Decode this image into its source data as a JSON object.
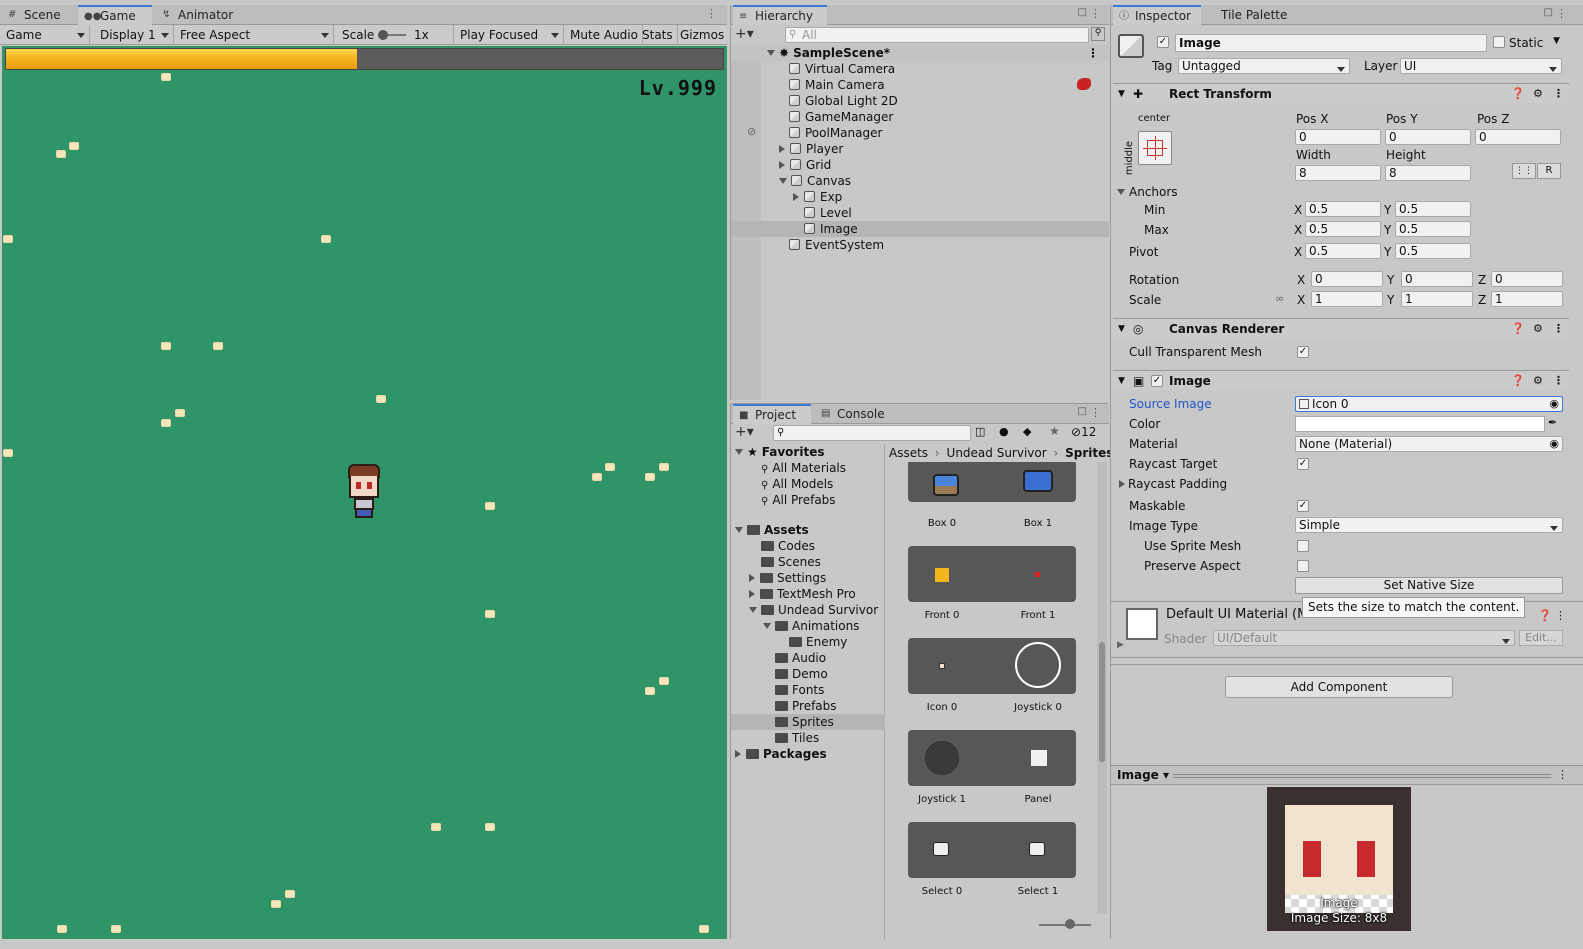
{
  "game_panel": {
    "tabs": [
      {
        "label": "Scene",
        "icon": "hash-icon"
      },
      {
        "label": "Game",
        "icon": "gamepad-icon"
      },
      {
        "label": "Animator",
        "icon": "animator-icon"
      }
    ],
    "toolbar": {
      "game_mode": "Game",
      "display": "Display 1",
      "aspect": "Free Aspect",
      "scale_label": "Scale",
      "scale_value": "1x",
      "play_focused": "Play Focused",
      "mute_audio": "Mute Audio",
      "stats": "Stats",
      "gizmos": "Gizmos"
    },
    "exp_bar_fill": 0.49,
    "level_text": "Lv.999",
    "colors": {
      "grass": "#2f9467",
      "exp_bar": "#f5b51e"
    }
  },
  "hierarchy": {
    "tab": "Hierarchy",
    "search_placeholder": "All",
    "scene": "SampleScene*",
    "items": [
      {
        "label": "Virtual Camera"
      },
      {
        "label": "Main Camera"
      },
      {
        "label": "Global Light 2D"
      },
      {
        "label": "GameManager"
      },
      {
        "label": "PoolManager"
      },
      {
        "label": "Player"
      },
      {
        "label": "Grid"
      },
      {
        "label": "Canvas"
      },
      {
        "label": "Exp"
      },
      {
        "label": "Level"
      },
      {
        "label": "Image"
      },
      {
        "label": "EventSystem"
      }
    ]
  },
  "project": {
    "tabs": [
      {
        "label": "Project"
      },
      {
        "label": "Console"
      }
    ],
    "hidden_count": "12",
    "tree": {
      "favorites": "Favorites",
      "all_materials": "All Materials",
      "all_models": "All Models",
      "all_prefabs": "All Prefabs",
      "assets": "Assets",
      "codes": "Codes",
      "scenes": "Scenes",
      "settings": "Settings",
      "textmesh": "TextMesh Pro",
      "undead": "Undead Survivor",
      "animations": "Animations",
      "enemy": "Enemy",
      "audio": "Audio",
      "demo": "Demo",
      "fonts": "Fonts",
      "prefabs": "Prefabs",
      "sprites": "Sprites",
      "tiles": "Tiles",
      "packages": "Packages"
    },
    "breadcrumb": [
      "Assets",
      "Undead Survivor",
      "Sprites"
    ],
    "sprites": [
      {
        "left": "Box 0",
        "right": "Box 1"
      },
      {
        "left": "Front 0",
        "right": "Front 1"
      },
      {
        "left": "Icon 0",
        "right": "Joystick 0"
      },
      {
        "left": "Joystick 1",
        "right": "Panel"
      },
      {
        "left": "Select 0",
        "right": "Select 1"
      }
    ]
  },
  "inspector": {
    "tabs": [
      {
        "label": "Inspector"
      },
      {
        "label": "Tile Palette"
      }
    ],
    "object_name": "Image",
    "static_label": "Static",
    "tag_label": "Tag",
    "tag_value": "Untagged",
    "layer_label": "Layer",
    "layer_value": "UI",
    "rect_transform": {
      "title": "Rect Transform",
      "anchor_h": "center",
      "anchor_v": "middle",
      "pos_x_label": "Pos X",
      "pos_y_label": "Pos Y",
      "pos_z_label": "Pos Z",
      "pos_x": "0",
      "pos_y": "0",
      "pos_z": "0",
      "width_label": "Width",
      "height_label": "Height",
      "width": "8",
      "height": "8",
      "r_button": "R",
      "anchors_label": "Anchors",
      "min_label": "Min",
      "max_label": "Max",
      "min_x": "0.5",
      "min_y": "0.5",
      "max_x": "0.5",
      "max_y": "0.5",
      "pivot_label": "Pivot",
      "pivot_x": "0.5",
      "pivot_y": "0.5",
      "rotation_label": "Rotation",
      "rot_x": "0",
      "rot_y": "0",
      "rot_z": "0",
      "scale_label": "Scale",
      "scale_x": "1",
      "scale_y": "1",
      "scale_z": "1",
      "x": "X",
      "y": "Y",
      "z": "Z"
    },
    "canvas_renderer": {
      "title": "Canvas Renderer",
      "cull_label": "Cull Transparent Mesh"
    },
    "image": {
      "title": "Image",
      "source_label": "Source Image",
      "source_value": "Icon 0",
      "color_label": "Color",
      "material_label": "Material",
      "material_value": "None (Material)",
      "raycast_target_label": "Raycast Target",
      "raycast_padding_label": "Raycast Padding",
      "maskable_label": "Maskable",
      "image_type_label": "Image Type",
      "image_type_value": "Simple",
      "use_sprite_mesh_label": "Use Sprite Mesh",
      "preserve_aspect_label": "Preserve Aspect",
      "set_native_size": "Set Native Size",
      "tooltip": "Sets the size to match the content."
    },
    "material": {
      "title": "Default UI Material (M",
      "shader_label": "Shader",
      "shader_value": "UI/Default",
      "edit": "Edit..."
    },
    "add_component": "Add Component",
    "preview": {
      "title": "Image",
      "caption_name": "Image",
      "caption_size": "Image Size: 8x8"
    }
  }
}
